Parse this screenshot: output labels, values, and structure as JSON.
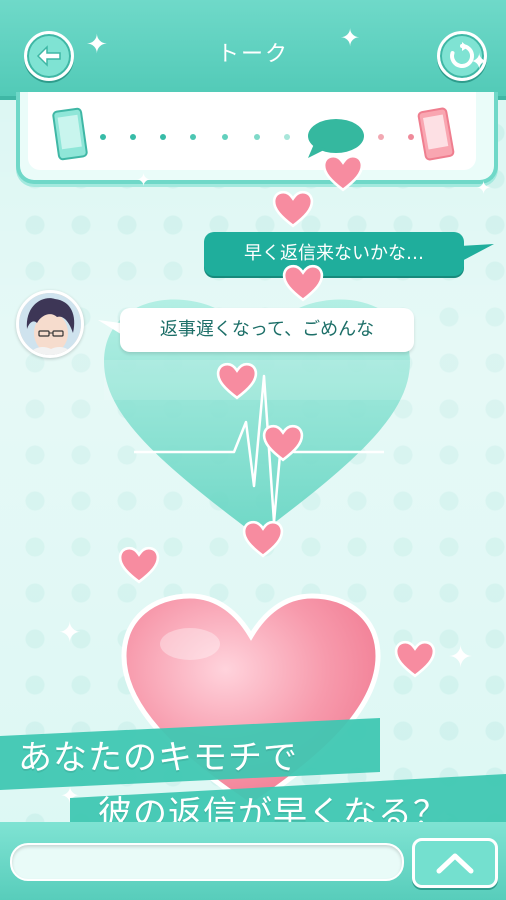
{
  "header": {
    "title": "トーク",
    "back_icon": "arrow-left-icon",
    "refresh_icon": "refresh-icon"
  },
  "progress": {
    "left_icon": "phone-icon",
    "right_icon": "phone-icon",
    "marker_icon": "speech-bubble-icon",
    "position": 0.72
  },
  "chat": {
    "my_message": "早く返信来ないかな…",
    "his_message": "返事遅くなって、ごめんな"
  },
  "banner": {
    "line1": "あなたのキモチで",
    "line2": "彼の返信が早くなる？"
  },
  "colors": {
    "accent": "#52cab7",
    "bubble_me": "#1fae9c",
    "heart_pink": "#f78ca0"
  }
}
